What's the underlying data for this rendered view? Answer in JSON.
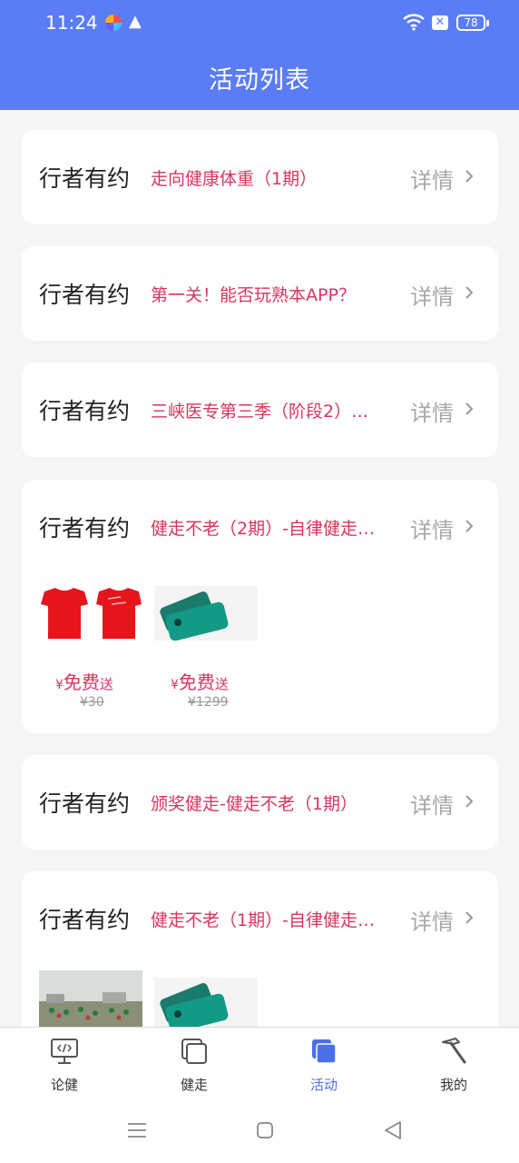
{
  "status_bar": {
    "time": "11:24",
    "warning_glyph": "▲",
    "x_badge": "✕",
    "battery": "78"
  },
  "header": {
    "title": "活动列表"
  },
  "activities": [
    {
      "org": "行者有约",
      "name": "走向健康体重（1期）",
      "detail": "详情"
    },
    {
      "org": "行者有约",
      "name": "第一关！能否玩熟本APP？",
      "detail": "详情"
    },
    {
      "org": "行者有约",
      "name": "三峡医专第三季（阶段2）…",
      "detail": "详情"
    },
    {
      "org": "行者有约",
      "name": "健走不老（2期）-自律健走…",
      "detail": "详情",
      "products": [
        {
          "yen": "¥",
          "price": "免费",
          "tag": "送",
          "original": "¥30",
          "icon": "red-tshirts-image"
        },
        {
          "yen": "¥",
          "price": "免费",
          "tag": "送",
          "original": "¥1299",
          "icon": "green-phone-image"
        }
      ]
    },
    {
      "org": "行者有约",
      "name": "颁奖健走-健走不老（1期）",
      "detail": "详情"
    },
    {
      "org": "行者有约",
      "name": "健走不老（1期）-自律健走…",
      "detail": "详情",
      "products": [
        {
          "icon": "walking-crowd-photo"
        },
        {
          "icon": "green-phone-image"
        }
      ]
    }
  ],
  "tabbar": {
    "tabs": [
      {
        "label": "论健",
        "icon": "monitor-code-icon"
      },
      {
        "label": "健走",
        "icon": "stacked-squares-icon"
      },
      {
        "label": "活动",
        "icon": "stacked-squares-filled-icon"
      },
      {
        "label": "我的",
        "icon": "hammer-icon"
      }
    ],
    "active_index": 2
  },
  "colors": {
    "header": "#5a7cf5",
    "accent": "#4b6fe8",
    "activity_name": "#d8355e",
    "background": "#f5f5f7"
  }
}
